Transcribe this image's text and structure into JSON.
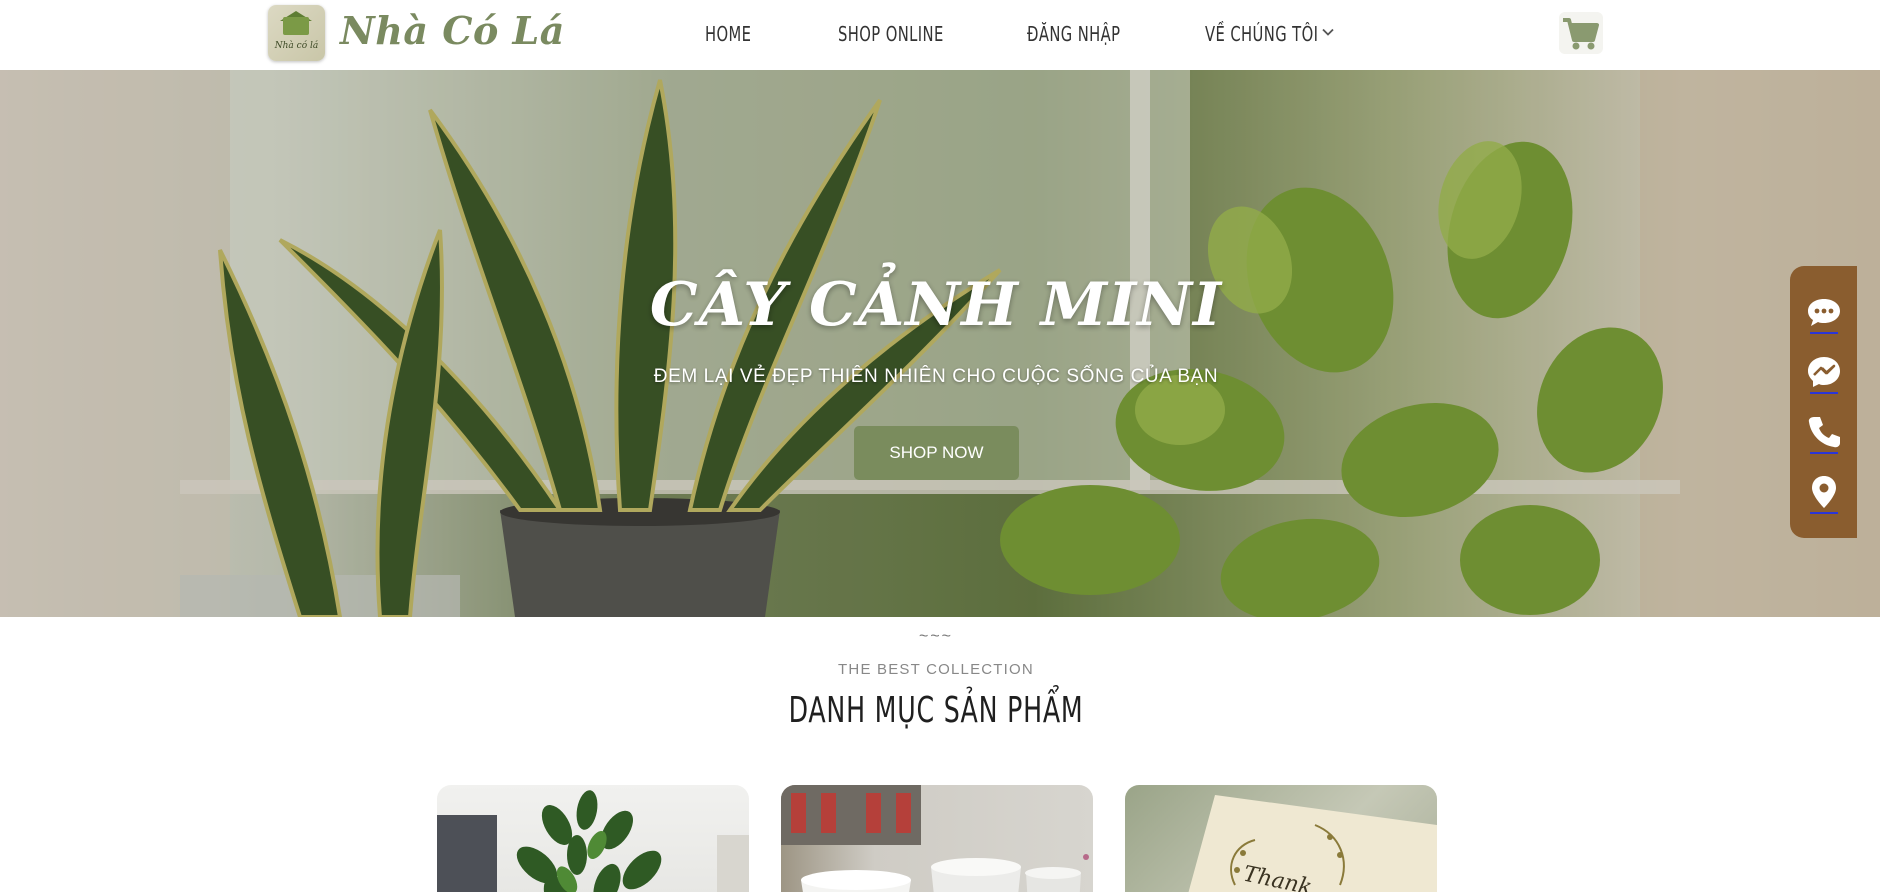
{
  "header": {
    "logo_alt": "Nhà có lá",
    "brand": "Nhà Có Lá",
    "nav": {
      "home": "HOME",
      "shop_online": "SHOP ONLINE",
      "login": "ĐĂNG NHẬP",
      "about": "VỀ CHÚNG TÔI"
    },
    "icons": {
      "about_dropdown": "chevron-down-icon",
      "cart": "cart-icon"
    }
  },
  "hero": {
    "title": "CÂY CẢNH MINI",
    "subtitle": "ĐEM LẠI VẺ ĐẸP THIÊN NHIÊN CHO CUỘC SỐNG CỦA BẠN",
    "cta": "SHOP NOW"
  },
  "contact_bar": {
    "icons": [
      "chat-icon",
      "messenger-icon",
      "phone-icon",
      "location-icon"
    ]
  },
  "section": {
    "ornament": "~~~",
    "kicker": "THE BEST COLLECTION",
    "title": "DANH MỤC SẢN PHẨM"
  },
  "categories": [
    {
      "image": "zz-plant-photo"
    },
    {
      "image": "white-pots-photo"
    },
    {
      "image": "thank-you-card-photo",
      "text": "Thank"
    }
  ],
  "colors": {
    "brand_green": "#7a8c5d",
    "contact_bar": "#8a5d2f",
    "cart": "#8a9a70"
  }
}
